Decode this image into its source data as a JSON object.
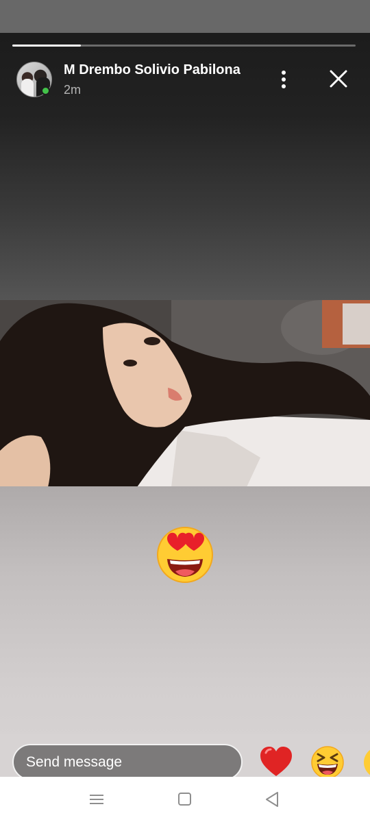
{
  "story": {
    "progress": 0.2,
    "username": "M Drembo Solivio Pabilona",
    "time": "2m",
    "online": true
  },
  "reply": {
    "placeholder": "Send message",
    "quick_reactions": [
      "heart-reaction",
      "laughing-reaction",
      "partial-reaction"
    ]
  },
  "icons": {
    "more": "more-vertical-icon",
    "close": "close-icon",
    "sticker": "heart-eyes-emoji"
  },
  "colors": {
    "online": "#43c34a",
    "heart": "#e02424",
    "emoji_yellow": "#ffcc33"
  }
}
